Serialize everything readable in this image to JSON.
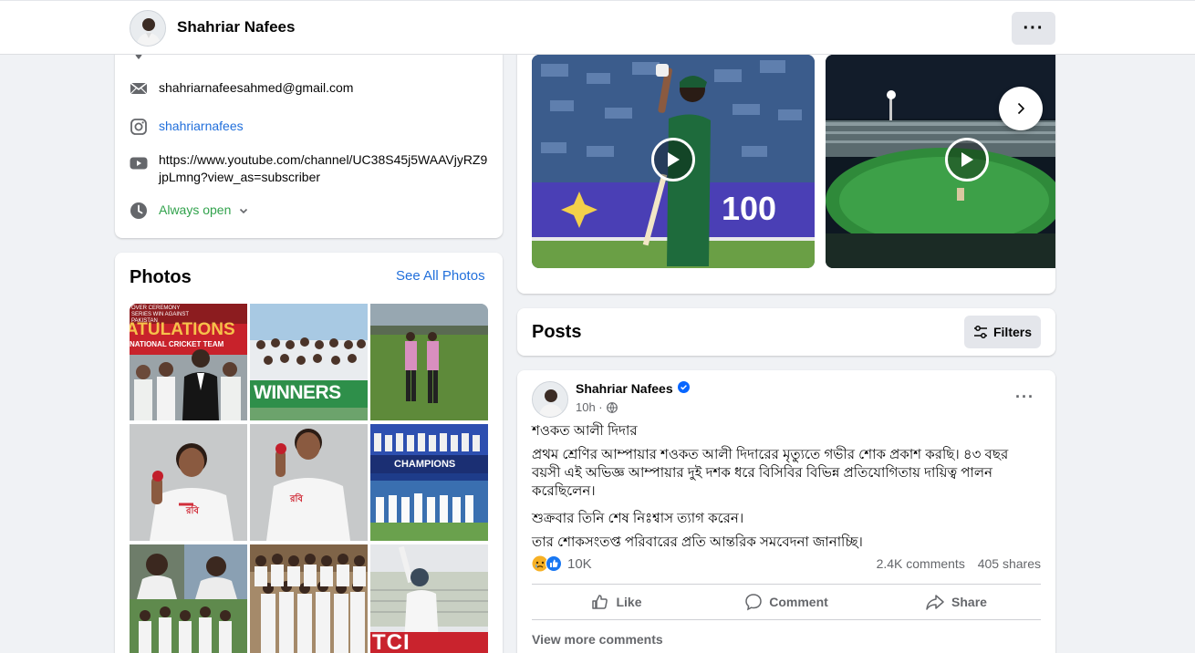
{
  "header": {
    "profile_name": "Shahriar Nafees",
    "more_label": "···"
  },
  "intro": {
    "email": "shahriarnafeesahmed@gmail.com",
    "instagram": "shahriarnafees",
    "youtube_line1": "https://www.youtube.com/channel/UC38S45j5WAAVjyRZ9",
    "youtube_line2": "jpLmng?view_as=subscriber",
    "hours": "Always open",
    "icons": [
      "location-icon",
      "email-icon",
      "instagram-icon",
      "youtube-icon",
      "clock-icon",
      "chevron-down-icon"
    ]
  },
  "photos": {
    "title": "Photos",
    "see_all": "See All Photos",
    "banner_text_1": "ATULATIONS",
    "banner_text_2": "NATIONAL CRICKET TEAM",
    "banner_small": "OVER CEREMONY SERIES WIN AGAINST PAKISTAN",
    "winners_text": "WINNERS",
    "champions_text": "CHAMPIONS",
    "jersey_text": "রবি",
    "tc_text": "TCI"
  },
  "videos": {
    "scoreboard_text": "100",
    "next_icon": "chevron-right-icon"
  },
  "posts_header": {
    "title": "Posts",
    "filters_label": "Filters"
  },
  "post": {
    "author": "Shahriar Nafees",
    "time": "10h ·",
    "line_title": "শওকত আলী দিদার",
    "paragraph1": "প্রথম শ্রেণির আম্পায়ার শওকত আলী দিদারের মৃত্যুতে গভীর শোক প্রকাশ করছি। ৪৩ বছর বয়সী এই অভিজ্ঞ আম্পায়ার দুই দশক ধরে বিসিবির বিভিন্ন প্রতিযোগিতায় দায়িত্ব পালন করেছিলেন।",
    "paragraph2": "শুক্রবার তিনি শেষ নিঃশ্বাস ত্যাগ করেন।",
    "paragraph3": "তার শোকসংতপ্ত পরিবারের প্রতি আন্তরিক সমবেদনা জানাচ্ছি।",
    "reaction_count": "10K",
    "comments": "2.4K comments",
    "shares": "405 shares",
    "like_label": "Like",
    "comment_label": "Comment",
    "share_label": "Share",
    "view_more": "View more comments",
    "colors": {
      "link": "#216fdb",
      "verified": "#0866ff",
      "like_blue": "#1877f2",
      "sad_yellow": "#f7b125"
    }
  }
}
